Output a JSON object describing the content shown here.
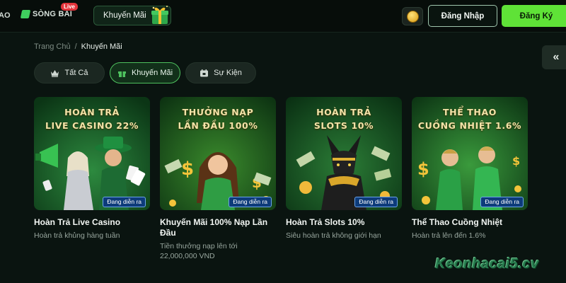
{
  "header": {
    "nav_partial": "AO",
    "nav_song_bai": "SÒNG BÀI",
    "live_badge": "Live",
    "nav_promotions": "Khuyến Mãi",
    "login": "Đăng Nhập",
    "register": "Đăng Ký"
  },
  "breadcrumb": {
    "home": "Trang Chủ",
    "separator": "/",
    "current": "Khuyến Mãi"
  },
  "filters": [
    {
      "label": "Tất Cả",
      "icon": "crown-icon",
      "active": false
    },
    {
      "label": "Khuyến Mãi",
      "icon": "gift-icon",
      "active": true
    },
    {
      "label": "Sự Kiện",
      "icon": "calendar-icon",
      "active": false
    }
  ],
  "cards": [
    {
      "heading": "HOÀN TRẢ\nLIVE CASINO 22%",
      "badge": "Đang diễn ra",
      "title": "Hoàn Trả Live Casino",
      "subtitle": "Hoàn trả khủng hàng tuần"
    },
    {
      "heading": "THƯỞNG NẠP\nLẦN ĐẦU 100%",
      "badge": "Đang diễn ra",
      "title": "Khuyến Mãi 100% Nạp Lần Đầu",
      "subtitle": "Tiền thưởng nạp lên tới 22,000,000 VND"
    },
    {
      "heading": "HOÀN TRẢ\nSLOTS 10%",
      "badge": "Đang diễn ra",
      "title": "Hoàn Trả Slots 10%",
      "subtitle": "Siêu hoàn trả không giới hạn"
    },
    {
      "heading": "THỂ THAO\nCUỒNG NHIỆT 1.6%",
      "badge": "Đang diễn ra",
      "title": "Thể Thao Cuồng Nhiệt",
      "subtitle": "Hoàn trả lên đến 1.6%"
    }
  ],
  "watermark": "Keonhacai5.cv",
  "colors": {
    "accent_green": "#5fe237",
    "active_filter_border": "#4ec15e",
    "badge_blue": "#0d3b7a",
    "live_red": "#e3343b"
  }
}
